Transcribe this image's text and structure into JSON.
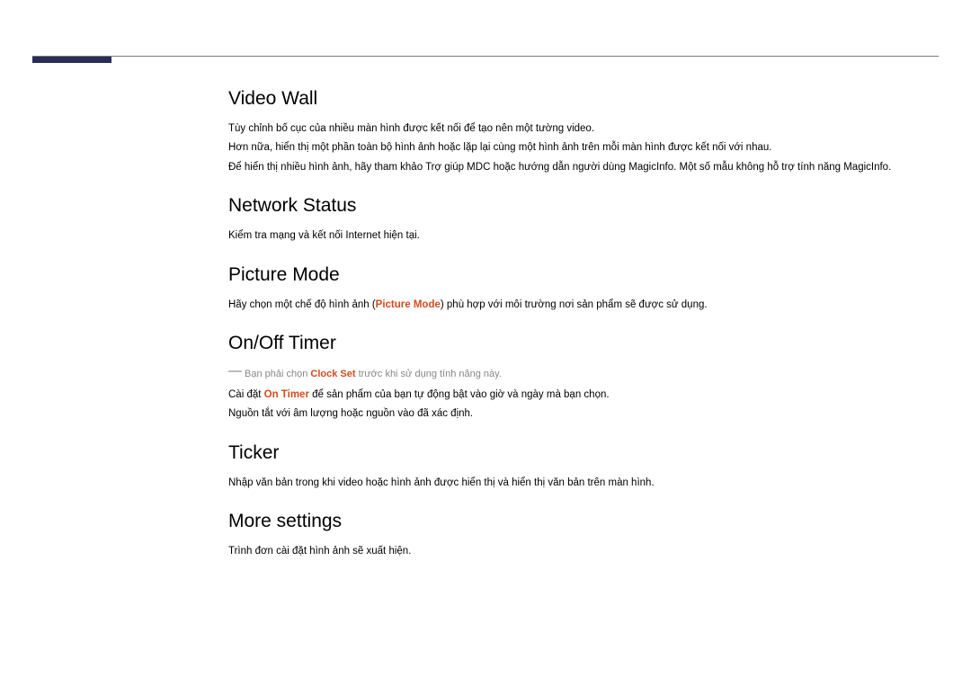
{
  "sections": {
    "videoWall": {
      "title": "Video Wall",
      "p1": "Tùy chỉnh bố cục của nhiều màn hình được kết nối để tạo nên một tường video.",
      "p2": "Hơn nữa, hiển thị một phần toàn bộ hình ảnh hoặc lặp lại cùng một hình ảnh trên mỗi màn hình được kết nối với nhau.",
      "p3": "Để hiển thị nhiều hình ảnh, hãy tham khảo Trợ giúp MDC hoặc hướng dẫn người dùng MagicInfo. Một số mẫu không hỗ trợ tính năng MagicInfo."
    },
    "networkStatus": {
      "title": "Network Status",
      "p1": "Kiểm tra mạng và kết nối Internet hiện tại."
    },
    "pictureMode": {
      "title": "Picture Mode",
      "p1a": "Hãy chọn một chế độ hình ảnh (",
      "p1hl": "Picture Mode",
      "p1b": ") phù hợp với môi trường nơi sản phẩm sẽ được sử dụng."
    },
    "onOffTimer": {
      "title": "On/Off Timer",
      "note_a": "Bạn phải chọn ",
      "note_hl": "Clock Set",
      "note_b": " trước khi sử dụng tính năng này.",
      "p1a": "Cài đặt ",
      "p1hl": "On Timer",
      "p1b": " để sản phẩm của bạn tự động bật vào giờ và ngày mà bạn chọn.",
      "p2": "Nguồn tắt với âm lượng hoặc nguồn vào đã xác định."
    },
    "ticker": {
      "title": "Ticker",
      "p1": "Nhập văn bản trong khi video hoặc hình ảnh được hiển thị và hiển thị văn bản trên màn hình."
    },
    "moreSettings": {
      "title": "More settings",
      "p1": "Trình đơn cài đặt hình ảnh sẽ xuất hiện."
    }
  }
}
